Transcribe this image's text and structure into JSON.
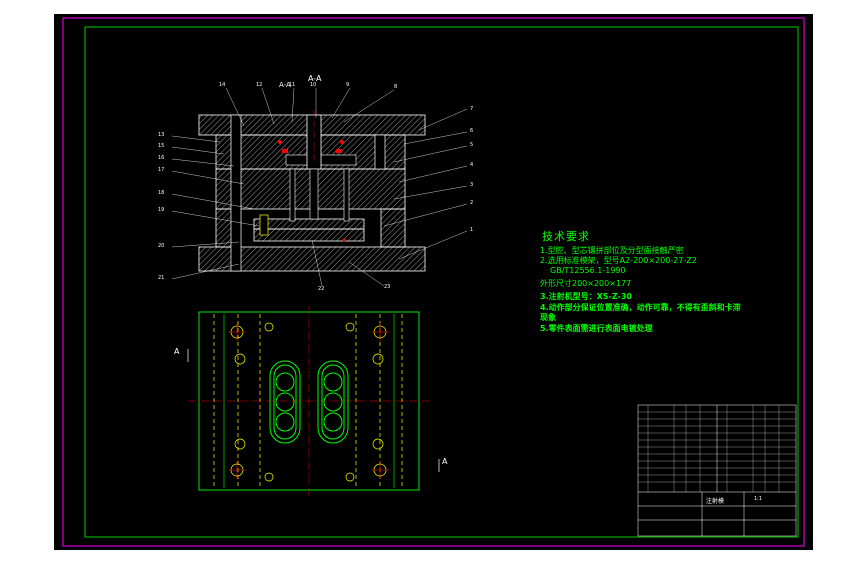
{
  "section_label": "A-A",
  "view_markers": {
    "left": "A",
    "right": "A"
  },
  "balloons": [
    "14",
    "12",
    "11",
    "10",
    "9",
    "8",
    "7",
    "6",
    "5",
    "4",
    "3",
    "2",
    "1",
    "13",
    "15",
    "16",
    "17",
    "18",
    "19",
    "20",
    "21",
    "22",
    "23"
  ],
  "tech_requirements": {
    "title": "技术要求",
    "items": [
      "1.型腔、型芯镶拼部位及分型面接触严密",
      "2.选用标准模架，型号A2-200×200-27-Z2",
      "GB/T12556.1-1990",
      "外形尺寸200×200×177",
      "3.注射机型号：XS-Z-30",
      "4.动作部分保证位置准确，动作可靠，不得有歪斜和卡滞",
      "现象",
      "5.零件表面需进行表面电镀处理"
    ]
  },
  "title_block": {
    "drawing_name": "注射模",
    "scale": "1:1"
  },
  "colors": {
    "background": "#000000",
    "outline": "#ffffff",
    "hatch": "#ff0000",
    "centerline": "#ff0000",
    "section_body": "#ffffff",
    "plan_view": "#00ff00",
    "frame_inner": "#00ff00",
    "frame_outer": "#ff00ff",
    "text": "#00ff00",
    "screw": "#ffff00"
  }
}
